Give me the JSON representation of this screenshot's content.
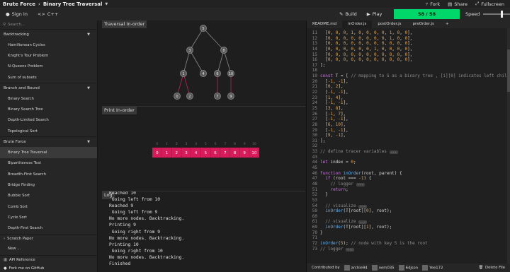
{
  "topbar": {
    "category": "Brute Force",
    "algorithm": "Binary Tree Traversal",
    "fork_label": "Fork",
    "share_label": "Share",
    "fullscreen_label": "Fullscreen"
  },
  "secondbar": {
    "sign_in": "Sign In",
    "language": "C++",
    "build": "Build",
    "play": "Play",
    "progress_label": "58 / 58",
    "progress_fraction": 1.0,
    "speed_label": "Speed",
    "speed_fraction": 0.55,
    "progress_color": "#00d76a"
  },
  "sidebar": {
    "search_placeholder": "Search...",
    "sections": [
      {
        "label": "Backtracking",
        "items": [
          "Hamiltonean Cycles",
          "Knight's Tour Problem",
          "N-Queens Problem",
          "Sum of subsets"
        ]
      },
      {
        "label": "Branch and Bound",
        "items": [
          "Binary Search",
          "Binary Search Tree",
          "Depth-Limited Search",
          "Topological Sort"
        ]
      },
      {
        "label": "Brute Force",
        "items": [
          "Binary Tree Traversal",
          "Bipartiteness Test",
          "Breadth-First Search",
          "Bridge Finding",
          "Bubble Sort",
          "Comb Sort",
          "Cycle Sort",
          "Depth-First Search"
        ]
      }
    ],
    "active_item": "Binary Tree Traversal",
    "scratch_paper": "Scratch Paper",
    "new_label": "New ...",
    "api_reference": "API Reference",
    "github": "Fork me on GitHub"
  },
  "tree_pane": {
    "tab": "Traversal In-order",
    "nodes": [
      "5",
      "3",
      "8",
      "1",
      "4",
      "6",
      "10",
      "0",
      "2",
      "7",
      "9"
    ]
  },
  "array_pane": {
    "tab": "Print In-order",
    "indices": [
      "0",
      "1",
      "2",
      "3",
      "4",
      "5",
      "6",
      "7",
      "8",
      "9",
      "10"
    ],
    "values": [
      "0",
      "1",
      "2",
      "3",
      "4",
      "5",
      "6",
      "7",
      "8",
      "9",
      "10"
    ],
    "highlight_color": "#d81b5b"
  },
  "log_pane": {
    "tab": "Log",
    "lines": [
      "Reached 10",
      " Going left from 10",
      "Reached 9",
      " Going left from 9",
      "No more nodes. Backtracking.",
      "Printing 9",
      " Going right from 9",
      "No more nodes. Backtracking.",
      "Printing 10",
      " Going right from 10",
      "No more nodes. Backtracking.",
      "Finished"
    ]
  },
  "code_pane": {
    "tabs": [
      "README.md",
      "inOrder.js",
      "postOrder.js",
      "preOrder.js"
    ],
    "active_tab": "inOrder.js",
    "add_tab": "+",
    "fold_marker": "...",
    "lines": [
      {
        "n": "11",
        "t": "  [0, 0, 0, 1, 0, 0, 0, 0, 1, 0, 0],"
      },
      {
        "n": "12",
        "t": "  [0, 0, 0, 0, 0, 0, 0, 0, 1, 0, 0],"
      },
      {
        "n": "13",
        "t": "  [0, 0, 0, 0, 0, 0, 0, 0, 0, 0, 0],"
      },
      {
        "n": "14",
        "t": "  [0, 0, 0, 0, 0, 0, 1, 0, 0, 0, 0],"
      },
      {
        "n": "15",
        "t": "  [0, 0, 0, 0, 0, 0, 0, 0, 0, 0, 0],"
      },
      {
        "n": "16",
        "t": "  [0, 0, 0, 0, 0, 0, 0, 0, 0, 0, 0],"
      },
      {
        "n": "17",
        "t": "];"
      },
      {
        "n": "18",
        "t": ""
      },
      {
        "n": "19",
        "t": "const T = [ // mapping to G as a binary tree , [i][0] indicates left child"
      },
      {
        "n": "20",
        "t": "  [-1, -1],"
      },
      {
        "n": "21",
        "t": "  [0, 2],"
      },
      {
        "n": "22",
        "t": "  [-1, -1],"
      },
      {
        "n": "23",
        "t": "  [1, 4],"
      },
      {
        "n": "24",
        "t": "  [-1, -1],"
      },
      {
        "n": "25",
        "t": "  [3, 8],"
      },
      {
        "n": "26",
        "t": "  [-1, 7],"
      },
      {
        "n": "27",
        "t": "  [-1, -1],"
      },
      {
        "n": "28",
        "t": "  [6, 10],"
      },
      {
        "n": "29",
        "t": "  [-1, -1],"
      },
      {
        "n": "30",
        "t": "  [9, -1],"
      },
      {
        "n": "31",
        "t": "];"
      },
      {
        "n": "32",
        "t": ""
      },
      {
        "n": "33",
        "t": "// define tracer variables {"
      },
      {
        "n": "43",
        "t": ""
      },
      {
        "n": "44",
        "t": "let index = 0;"
      },
      {
        "n": "45",
        "t": ""
      },
      {
        "n": "46",
        "t": "function inOrder(root, parent) {"
      },
      {
        "n": "47",
        "t": "  if (root === -1) {"
      },
      {
        "n": "48",
        "t": "    // logger {"
      },
      {
        "n": "51",
        "t": "    return;"
      },
      {
        "n": "52",
        "t": "  }"
      },
      {
        "n": "53",
        "t": ""
      },
      {
        "n": "54",
        "t": "  // visualize {"
      },
      {
        "n": "59",
        "t": "  inOrder(T[root][0], root);"
      },
      {
        "n": "60",
        "t": ""
      },
      {
        "n": "61",
        "t": "  // visualize {"
      },
      {
        "n": "69",
        "t": "  inOrder(T[root][1], root);"
      },
      {
        "n": "70",
        "t": "}"
      },
      {
        "n": "71",
        "t": ""
      },
      {
        "n": "72",
        "t": "inOrder(5); // node with key 5 is the root"
      },
      {
        "n": "73",
        "t": "// logger {"
      }
    ],
    "contributed_by": "Contributed by",
    "contributors": [
      "archie94",
      "nem035",
      "64json",
      "Yee172"
    ],
    "delete_file": "Delete File"
  }
}
